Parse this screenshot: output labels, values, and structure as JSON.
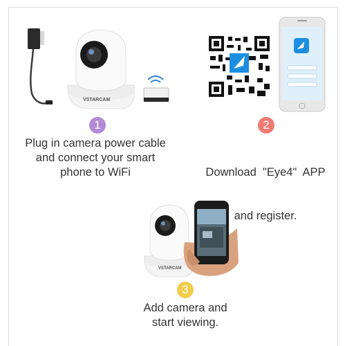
{
  "steps": [
    {
      "number": "1",
      "color": "#b28ad6",
      "lines": [
        "Plug in camera power cable",
        "and connect your smart",
        "phone to WiFi"
      ]
    },
    {
      "number": "2",
      "color": "#f07a72",
      "lines": [
        "Download  \"Eye4\"  APP",
        "and register."
      ]
    },
    {
      "number": "3",
      "color": "#f2cd4b",
      "lines": [
        "Add camera and",
        "start viewing."
      ]
    }
  ],
  "brand_text": "VSTARCAM",
  "app_icon_name": "eye4-app-icon"
}
